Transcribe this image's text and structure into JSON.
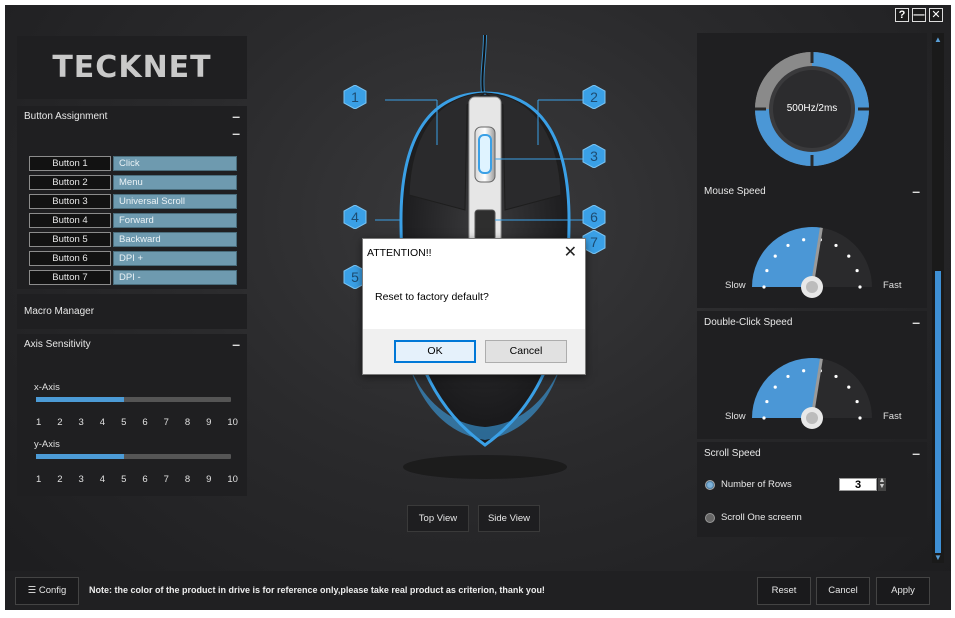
{
  "window": {
    "help_label": "?",
    "minimize_label": "—",
    "close_label": "✕"
  },
  "logo": "TECKNET",
  "button_assignment": {
    "title": "Button Assignment",
    "rows": [
      {
        "name": "Button 1",
        "value": "Click"
      },
      {
        "name": "Button 2",
        "value": "Menu"
      },
      {
        "name": "Button 3",
        "value": "Universal Scroll"
      },
      {
        "name": "Button 4",
        "value": "Forward"
      },
      {
        "name": "Button 5",
        "value": "Backward"
      },
      {
        "name": "Button 6",
        "value": "DPI +"
      },
      {
        "name": "Button 7",
        "value": "DPI -"
      }
    ]
  },
  "macro_manager": {
    "title": "Macro Manager"
  },
  "axis_sensitivity": {
    "title": "Axis Sensitivity",
    "x_label": "x-Axis",
    "y_label": "y-Axis",
    "x_level": 0.45,
    "y_level": 0.45,
    "ticks": [
      "1",
      "2",
      "3",
      "4",
      "5",
      "6",
      "7",
      "8",
      "9",
      "10"
    ]
  },
  "callouts": [
    "1",
    "2",
    "3",
    "4",
    "5",
    "6",
    "7"
  ],
  "views": {
    "top": "Top View",
    "side": "Side View"
  },
  "polling": {
    "value": "500Hz/2ms"
  },
  "mouse_speed": {
    "title": "Mouse Speed",
    "slow": "Slow",
    "fast": "Fast",
    "level": 0.55
  },
  "double_click": {
    "title": "Double-Click Speed",
    "slow": "Slow",
    "fast": "Fast",
    "level": 0.55
  },
  "scroll_speed": {
    "title": "Scroll Speed",
    "rows_label": "Number of Rows",
    "rows_value": "3",
    "screen_label": "Scroll One screenn"
  },
  "bottom": {
    "config": "Config",
    "note": "Note: the color of the product in drive is for reference only,please take real product as criterion, thank you!",
    "reset": "Reset",
    "cancel": "Cancel",
    "apply": "Apply"
  },
  "dialog": {
    "title": "ATTENTION!!",
    "message": "Reset to factory default?",
    "ok": "OK",
    "cancel": "Cancel"
  },
  "colors": {
    "accent": "#4c9bd6",
    "assignment_fill": "#6e9aaf",
    "glow": "#3aa0e6"
  }
}
